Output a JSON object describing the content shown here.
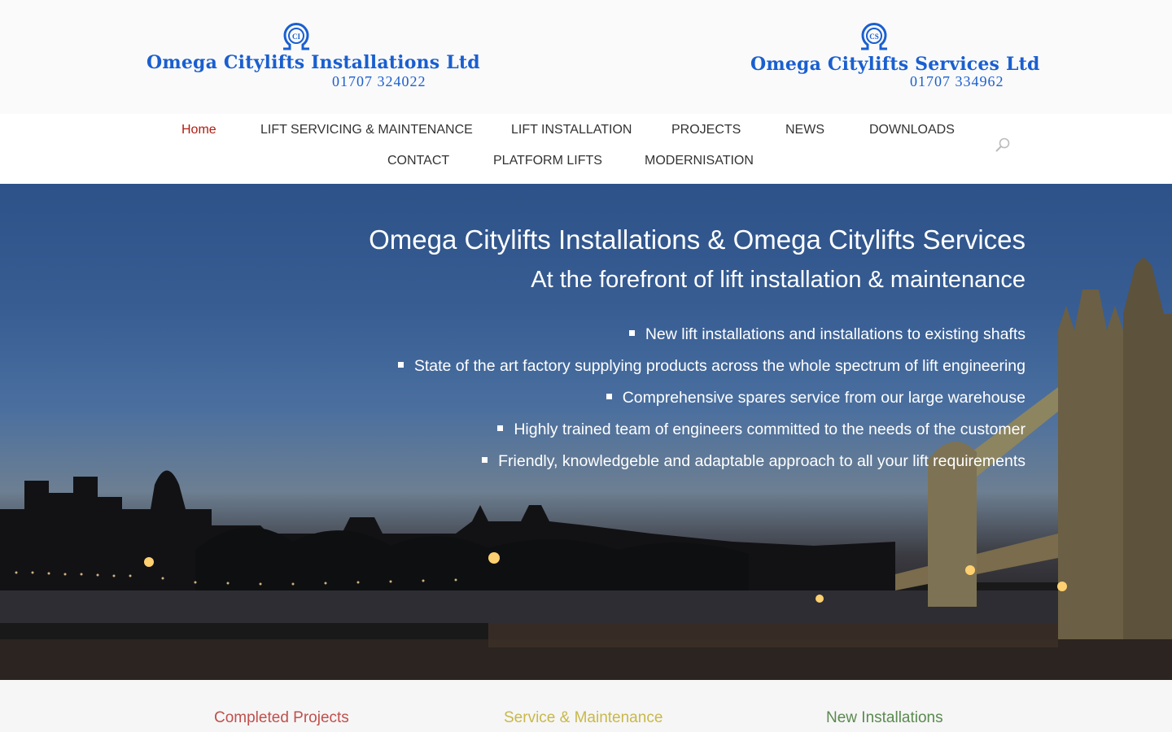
{
  "header": {
    "left_logo": {
      "name": "Omega Citylifts Installations Ltd",
      "phone": "01707 324022"
    },
    "right_logo": {
      "name": "Omega Citylifts Services Ltd",
      "phone": "01707 334962"
    },
    "brand_color": "#1a5fd0"
  },
  "nav": {
    "items": [
      "Home",
      "LIFT SERVICING & MAINTENANCE",
      "LIFT INSTALLATION",
      "PROJECTS",
      "NEWS",
      "DOWNLOADS",
      "CONTACT",
      "PLATFORM LIFTS",
      "MODERNISATION"
    ],
    "active_color": "#b01b12",
    "search_icon": "search-icon"
  },
  "hero": {
    "title": "Omega Citylifts Installations & Omega Citylifts Services",
    "subtitle": "At the forefront of lift installation & maintenance",
    "bullets": [
      "New lift installations and installations to existing shafts",
      "State of the art factory supplying products across the whole spectrum of lift engineering",
      "Comprehensive spares service from our large warehouse",
      "Highly trained team of engineers committed to the needs of the customer",
      "Friendly, knowledgeble and adaptable approach to all your lift requirements"
    ]
  },
  "sections": [
    {
      "title": "Completed Projects",
      "color": "#c0504d"
    },
    {
      "title": "Service & Maintenance",
      "color": "#c8b84a"
    },
    {
      "title": "New Installations",
      "color": "#5a8a4f"
    }
  ]
}
